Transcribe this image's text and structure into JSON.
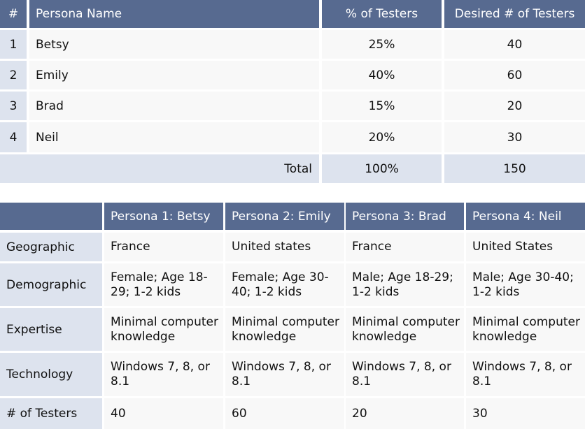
{
  "table1": {
    "headers": [
      "#",
      "Persona Name",
      "% of Testers",
      "Desired # of Testers"
    ],
    "rows": [
      {
        "num": "1",
        "name": "Betsy",
        "pct": "25%",
        "desired": "40"
      },
      {
        "num": "2",
        "name": "Emily",
        "pct": "40%",
        "desired": "60"
      },
      {
        "num": "3",
        "name": "Brad",
        "pct": "15%",
        "desired": "20"
      },
      {
        "num": "4",
        "name": "Neil",
        "pct": "20%",
        "desired": "30"
      }
    ],
    "total": {
      "label": "Total",
      "pct": "100%",
      "desired": "150"
    }
  },
  "table2": {
    "headers": [
      "",
      "Persona 1: Betsy",
      "Persona 2: Emily",
      "Persona 3: Brad",
      "Persona 4: Neil"
    ],
    "rows": [
      {
        "label": "Geographic",
        "values": [
          "France",
          "United states",
          "France",
          "United States"
        ]
      },
      {
        "label": "Demographic",
        "values": [
          "Female; Age 18-\n29; 1-2 kids",
          "Female; Age 30-\n40; 1-2 kids",
          "Male; Age 18-29;\n1-2 kids",
          "Male; Age 30-40;\n1-2 kids"
        ]
      },
      {
        "label": "Expertise",
        "values": [
          "Minimal computer\nknowledge",
          "Minimal computer\nknowledge",
          "Minimal computer\nknowledge",
          "Minimal computer\nknowledge"
        ]
      },
      {
        "label": "Technology",
        "values": [
          "Windows 7, 8, or\n8.1",
          "Windows 7, 8, or\n8.1",
          "Windows 7, 8, or\n8.1",
          "Windows 7, 8, or\n8.1"
        ]
      },
      {
        "label": "# of Testers",
        "values": [
          "40",
          "60",
          "20",
          "30"
        ]
      }
    ]
  },
  "colors": {
    "header_bg": "#576a90",
    "label_bg": "#dde3ee",
    "cell_bg": "#f8f8f8"
  }
}
